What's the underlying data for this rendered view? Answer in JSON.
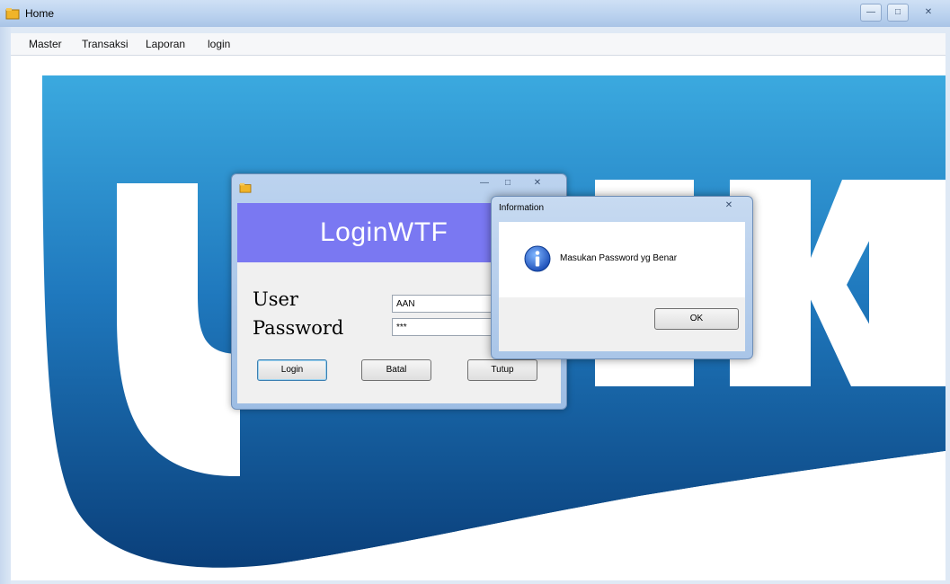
{
  "main_window": {
    "title": "Home",
    "controls": {
      "minimize": "—",
      "maximize": "□",
      "close": "✕"
    }
  },
  "menu": {
    "items": [
      "Master",
      "Transaksi",
      "Laporan",
      "login"
    ]
  },
  "background": {
    "logo_colors": {
      "dark_blue": "#0a4f8e",
      "light_blue": "#3ba9df",
      "white": "#ffffff"
    }
  },
  "login_window": {
    "header_title": "LoginWTF",
    "header_color": "#7a78f2",
    "controls": {
      "minimize": "—",
      "maximize": "□",
      "close": "✕"
    },
    "user_label": "User",
    "password_label": "Password",
    "user_value": "AAN",
    "password_value": "***",
    "buttons": {
      "login": "Login",
      "batal": "Batal",
      "tutup": "Tutup"
    }
  },
  "message_box": {
    "title": "Information",
    "close": "✕",
    "icon": "info-icon",
    "message": "Masukan Password yg Benar",
    "ok": "OK"
  }
}
